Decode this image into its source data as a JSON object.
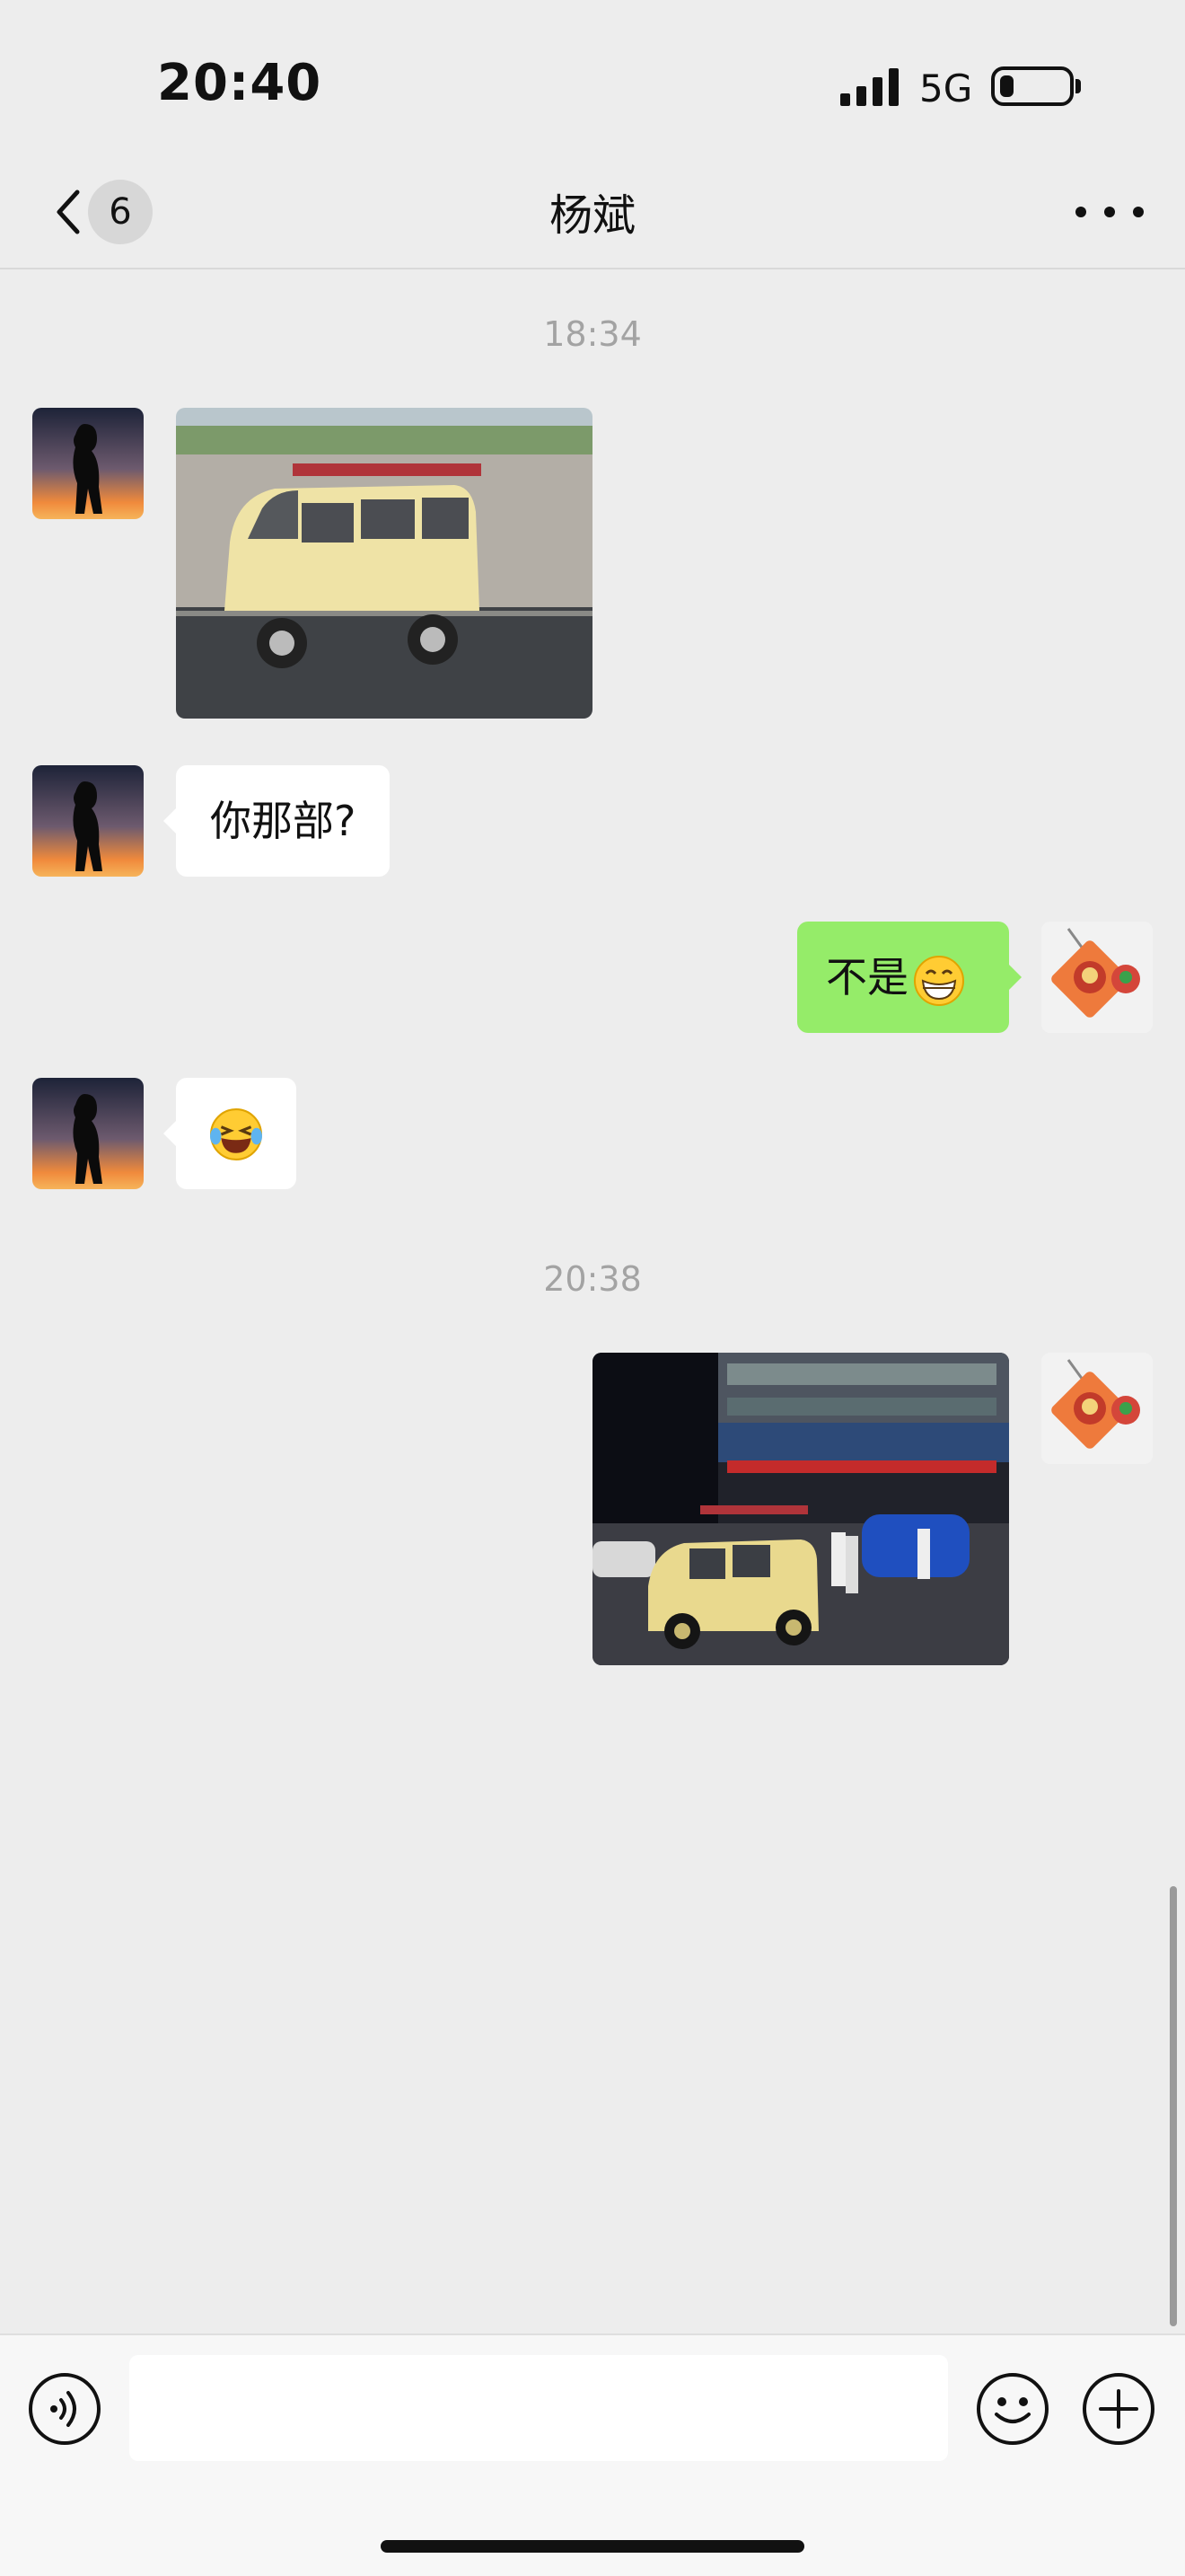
{
  "status_bar": {
    "time": "20:40",
    "network": "5G",
    "battery_percent": 20
  },
  "nav": {
    "back_icon": "chevron-left-icon",
    "unread_count": "6",
    "title": "杨斌",
    "more_icon": "more-icon"
  },
  "messages": [
    {
      "type": "timestamp",
      "text": "18:34"
    },
    {
      "type": "image",
      "from": "contact",
      "content": "yellow van parked by a wall"
    },
    {
      "type": "text",
      "from": "contact",
      "text": "你那部?"
    },
    {
      "type": "text",
      "from": "me",
      "text": "不是",
      "emoji": "grinning-face-icon"
    },
    {
      "type": "emoji",
      "from": "contact",
      "emoji": "laughing-tears-face-icon"
    },
    {
      "type": "timestamp",
      "text": "20:38"
    },
    {
      "type": "image",
      "from": "me",
      "content": "yellow van on a street at night"
    }
  ],
  "input_bar": {
    "voice_icon": "voice-icon",
    "input_value": "",
    "emoji_icon": "smiley-icon",
    "plus_icon": "plus-icon"
  },
  "colors": {
    "background": "#ededed",
    "outgoing_bubble": "#95ec69",
    "incoming_bubble": "#ffffff",
    "timestamp_text": "#a3a3a3"
  }
}
